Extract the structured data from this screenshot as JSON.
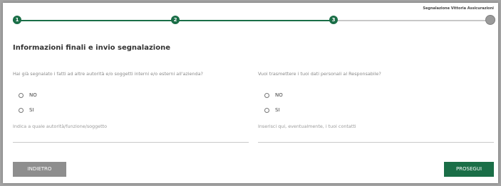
{
  "brand": "Segnalazione Vittoria Assicurazioni",
  "steps": [
    {
      "label": "1"
    },
    {
      "label": "2"
    },
    {
      "label": "3"
    }
  ],
  "title": "Informazioni finali e invio segnalazione",
  "left": {
    "question": "Hai già segnalato i fatti ad altre autorità e/o soggetti interni e/o esterni all'azienda?",
    "options": [
      "NO",
      "SI"
    ],
    "field_label": "Indica a quale autorità/funzione/soggetto"
  },
  "right": {
    "question": "Vuoi trasmettere i tuoi dati personali al Responsabile?",
    "options": [
      "NO",
      "SI"
    ],
    "field_label": "Inserisci qui, eventualmente, i tuoi contatti"
  },
  "buttons": {
    "back": "INDIETRO",
    "next": "PROSEGUI"
  },
  "colors": {
    "accent": "#1a6e47",
    "inactive": "#9a9a9a"
  }
}
